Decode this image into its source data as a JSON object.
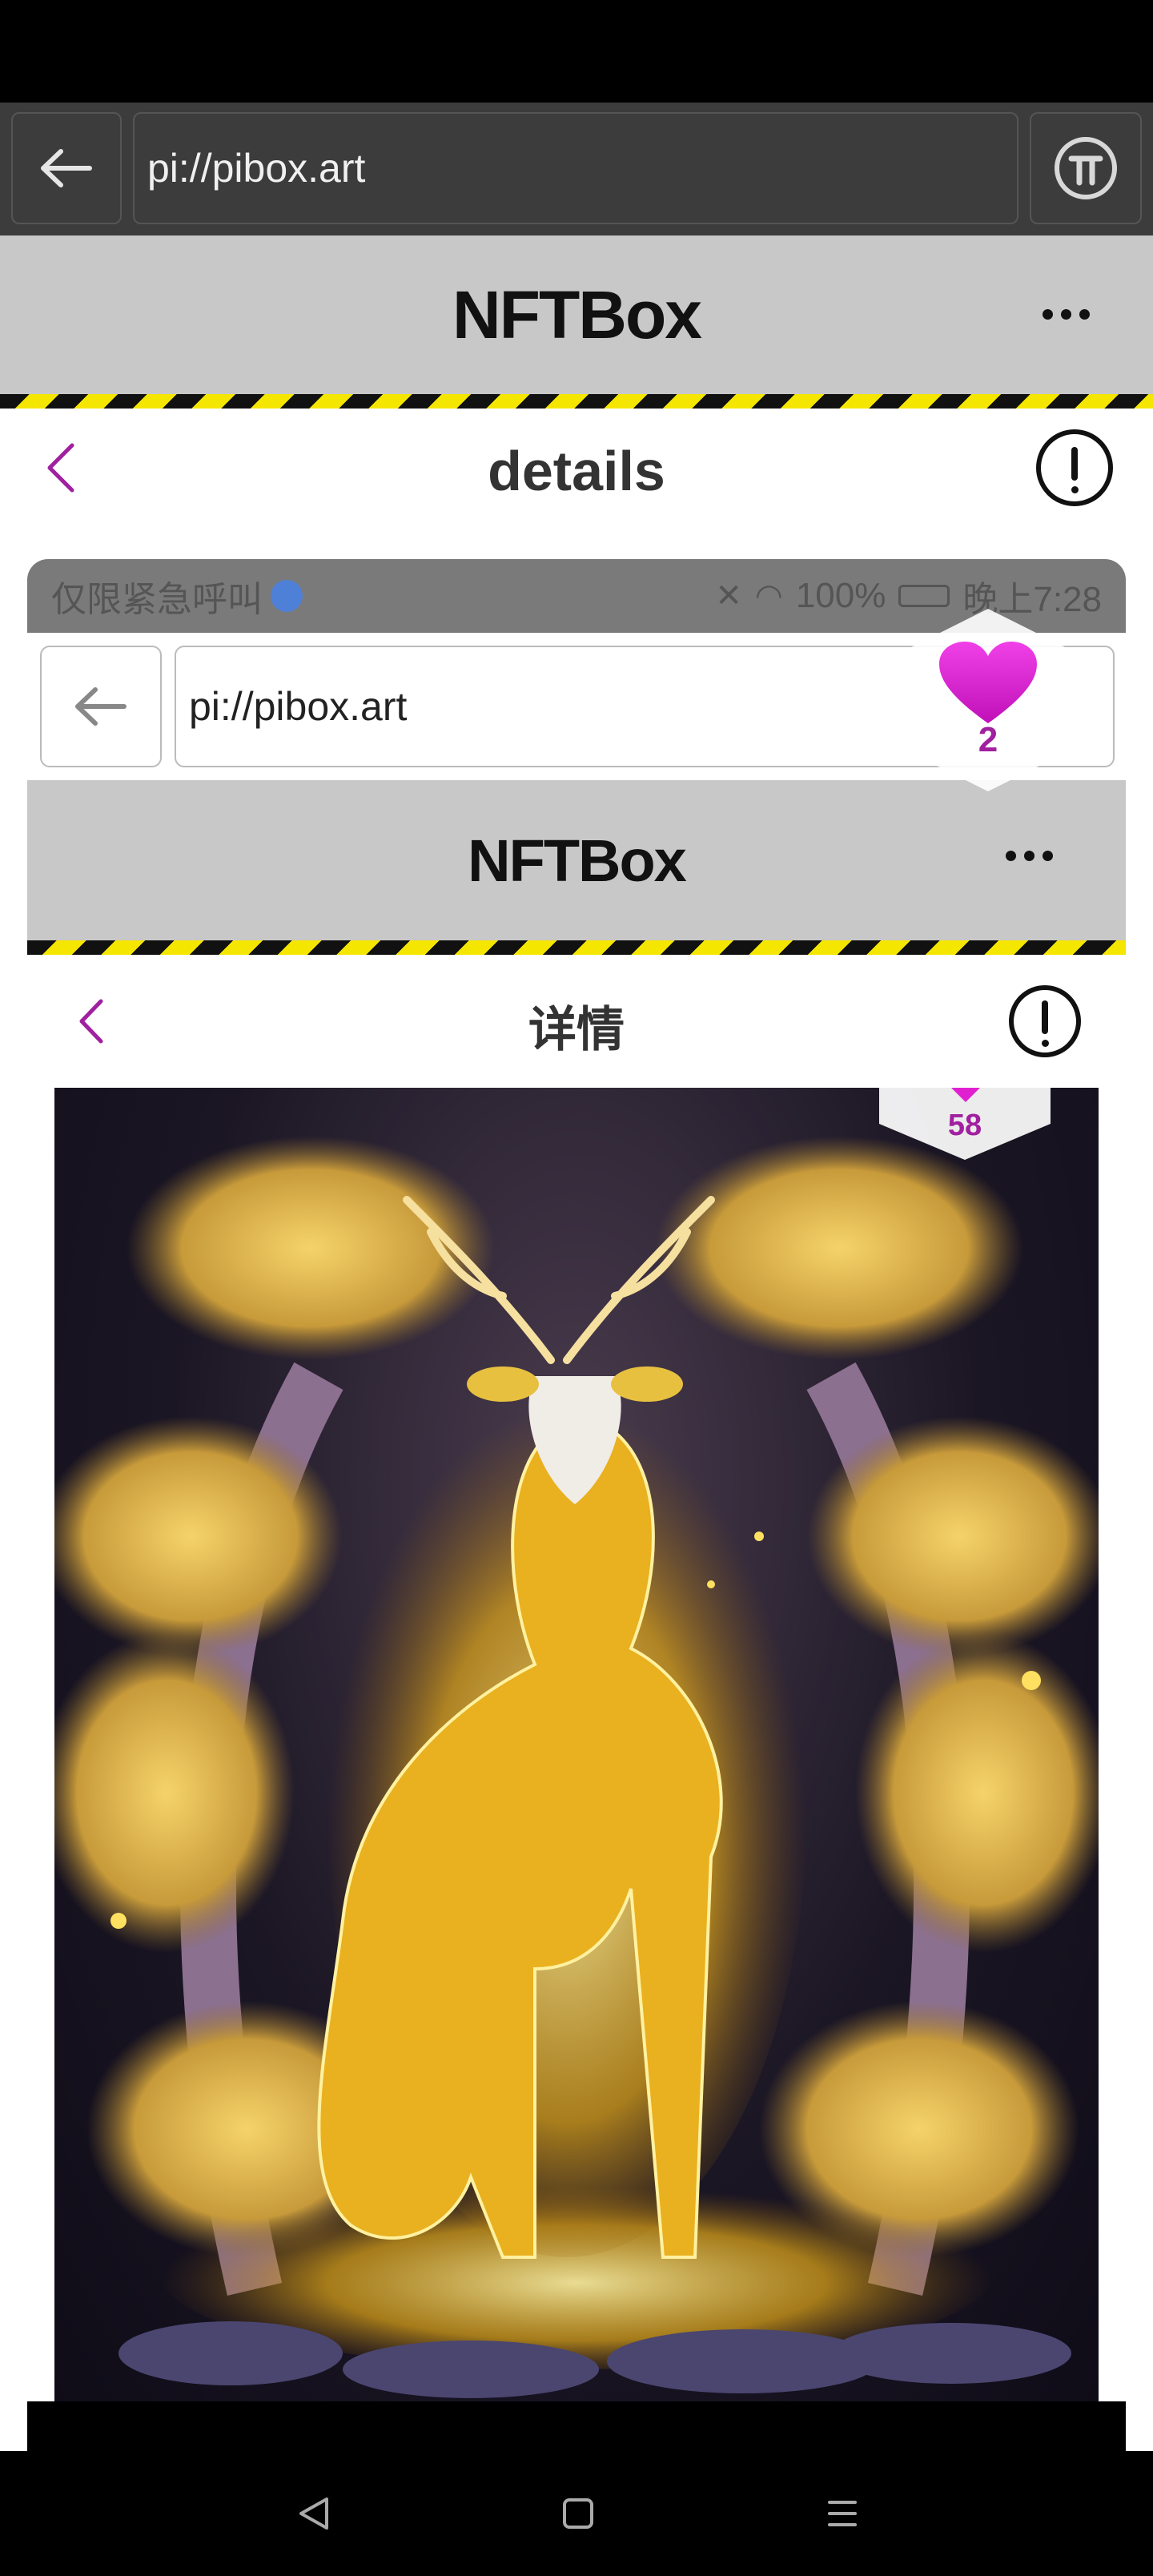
{
  "browser": {
    "url": "pi://pibox.art"
  },
  "app": {
    "title": "NFTBox"
  },
  "page": {
    "title": "details"
  },
  "inner": {
    "status_left": "仅限紧急呼叫",
    "battery": "100%",
    "time": "晚上7:28",
    "url": "pi://pibox.art",
    "app_title": "NFTBox",
    "page_title": "详情"
  },
  "likes": {
    "floating_count": "2",
    "inner_count": "58"
  },
  "colors": {
    "accent": "#a020a0",
    "heart": "#e020d0",
    "header_bg": "#c8c8c8",
    "hazard_yellow": "#f5e600"
  },
  "icons": {
    "back": "arrow-left-icon",
    "nav_back": "chevron-left-icon",
    "menu": "more-dots-icon",
    "report": "alert-circle-icon",
    "pi": "pi-logo-icon",
    "like": "heart-icon"
  }
}
